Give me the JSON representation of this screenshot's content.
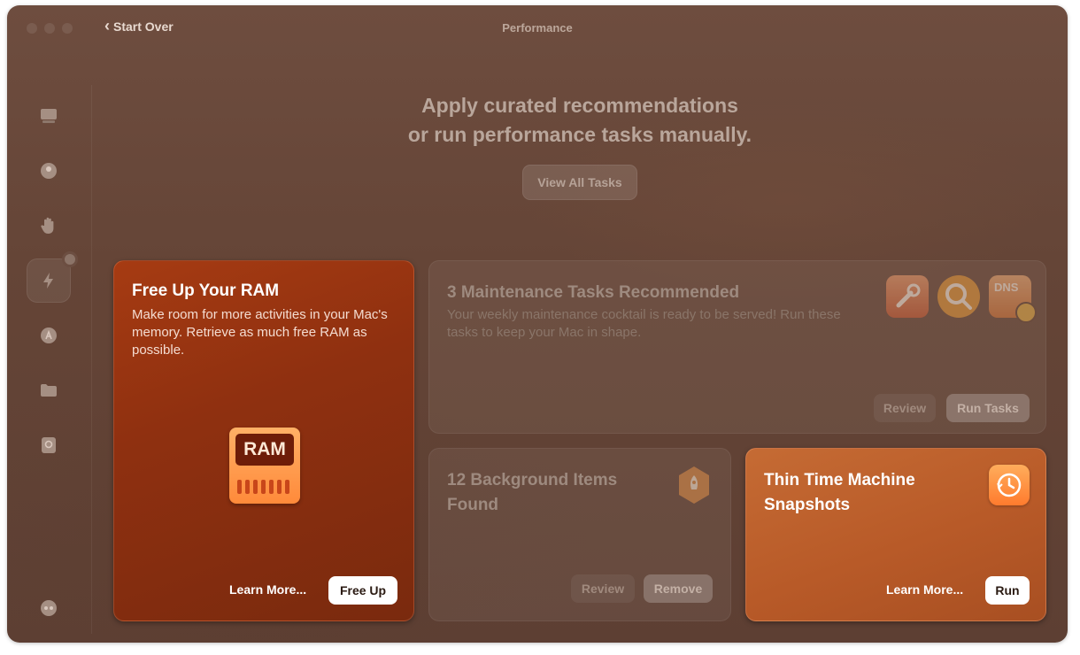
{
  "window": {
    "title": "Performance",
    "back_label": "Start Over"
  },
  "sidebar": {
    "items": [
      {
        "icon": "monitor-sweep-icon"
      },
      {
        "icon": "shield-icon"
      },
      {
        "icon": "hand-icon"
      },
      {
        "icon": "bolt-icon",
        "active": true
      },
      {
        "icon": "apps-icon"
      },
      {
        "icon": "folder-icon"
      },
      {
        "icon": "search-doc-icon"
      },
      {
        "icon": "assistant-icon"
      }
    ]
  },
  "header": {
    "line1": "Apply curated recommendations",
    "line2": "or run performance tasks manually.",
    "view_all_label": "View All Tasks"
  },
  "ram_card": {
    "title": "Free Up Your RAM",
    "description": "Make room for more activities in your Mac's memory. Retrieve as much free RAM as possible.",
    "icon_label": "RAM",
    "learn_more": "Learn More...",
    "action": "Free Up"
  },
  "maintenance_card": {
    "title": "3 Maintenance Tasks Recommended",
    "description": "Your weekly maintenance cocktail is ready to be served! Run these tasks to keep your Mac in shape.",
    "icon_dns": "DNS",
    "review": "Review",
    "action": "Run Tasks"
  },
  "background_card": {
    "title": "12 Background Items Found",
    "review": "Review",
    "action": "Remove"
  },
  "time_machine_card": {
    "title": "Thin Time Machine Snapshots",
    "learn_more": "Learn More...",
    "action": "Run"
  },
  "colors": {
    "accent": "#a63b12",
    "tm_accent": "#c56b34"
  }
}
